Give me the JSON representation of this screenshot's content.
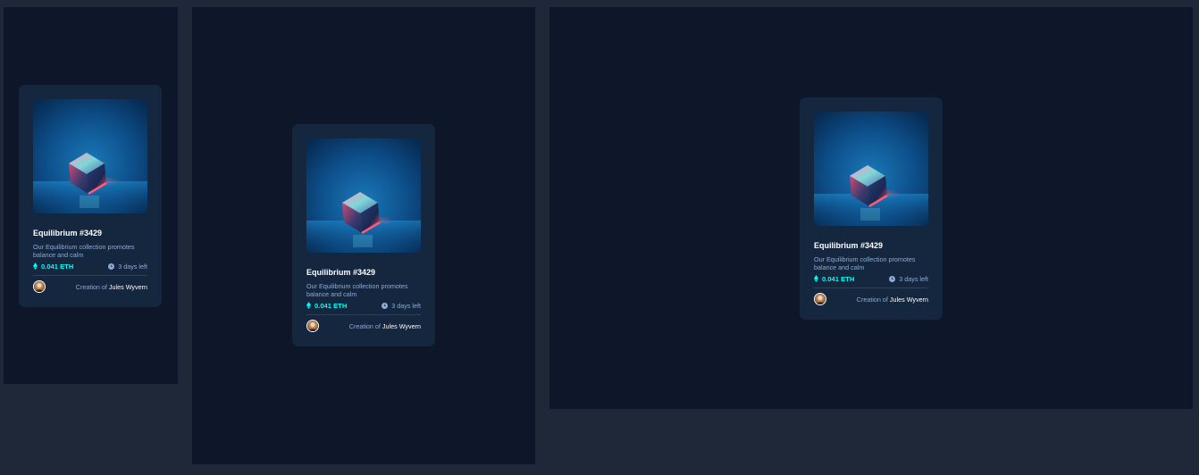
{
  "colors": {
    "page_background": "#1f2838",
    "panel_background": "#0d1729",
    "card_background": "#15263f",
    "accent_cyan": "#00fff8",
    "soft_blue": "#8bacd9",
    "white": "#ffffff"
  },
  "cards": [
    {
      "image_icon": "equilibrium-cube-image",
      "title": "Equilibrium #3429",
      "description": "Our Equilibrium collection promotes balance and calm",
      "price_icon": "ethereum-icon",
      "price": "0.041 ETH",
      "time_icon": "clock-icon",
      "time_left": "3 days left",
      "avatar_icon": "creator-avatar",
      "creation_prefix": "Creation of",
      "creator_name": "Jules Wyvern"
    },
    {
      "image_icon": "equilibrium-cube-image",
      "title": "Equilibrium #3429",
      "description": "Our Equilibrium collection promotes balance and calm",
      "price_icon": "ethereum-icon",
      "price": "0.041 ETH",
      "time_icon": "clock-icon",
      "time_left": "3 days left",
      "avatar_icon": "creator-avatar",
      "creation_prefix": "Creation of",
      "creator_name": "Jules Wyvern"
    },
    {
      "image_icon": "equilibrium-cube-image",
      "title": "Equilibrium #3429",
      "description": "Our Equilibrium collection promotes balance and calm",
      "price_icon": "ethereum-icon",
      "price": "0.041 ETH",
      "time_icon": "clock-icon",
      "time_left": "3 days left",
      "avatar_icon": "creator-avatar",
      "creation_prefix": "Creation of",
      "creator_name": "Jules Wyvern"
    }
  ]
}
